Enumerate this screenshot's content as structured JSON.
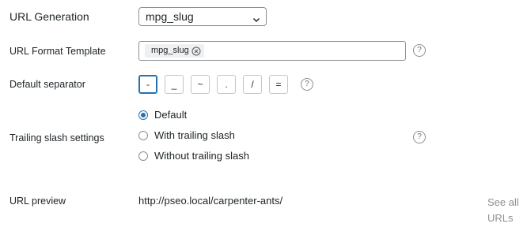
{
  "url_generation": {
    "label": "URL Generation",
    "selected": "mpg_slug"
  },
  "url_format_template": {
    "label": "URL Format Template",
    "tag": "mpg_slug"
  },
  "default_separator": {
    "label": "Default separator",
    "options": [
      "-",
      "_",
      "~",
      ".",
      "/",
      "="
    ],
    "selected": "-"
  },
  "trailing_slash": {
    "label": "Trailing slash settings",
    "options": [
      "Default",
      "With trailing slash",
      "Without trailing slash"
    ],
    "selected": "Default"
  },
  "url_preview": {
    "label": "URL preview",
    "value": "http://pseo.local/carpenter-ants/",
    "see_all": "See all URLs"
  },
  "help_glyph": "?"
}
